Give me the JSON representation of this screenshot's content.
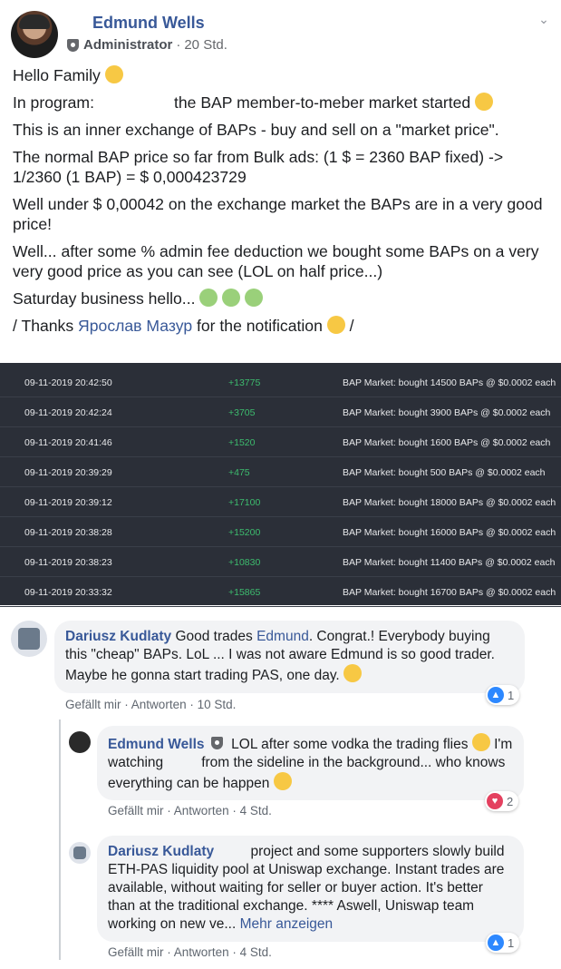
{
  "post": {
    "author": "Edmund Wells",
    "role": "Administrator",
    "time": "20 Std.",
    "lines": {
      "l1": "Hello Family",
      "l2a": "In program:",
      "l2b": "the BAP member-to-meber market started",
      "l3": "This is an inner exchange of BAPs - buy and sell on a \"market price\".",
      "l4": "The normal BAP price so far from Bulk ads: (1 $ = 2360 BAP fixed) -> 1/2360 (1 BAP) = $ 0,000423729",
      "l5": "Well under $ 0,00042 on the exchange market the BAPs are in a very good price!",
      "l6": "Well... after some % admin fee deduction we bought some BAPs on a very very good price as you can see (LOL on half price...)",
      "l7": "Saturday business hello...",
      "l8a": "/ Thanks",
      "l8_mention": "Ярослав Мазур",
      "l8b": "for the notification",
      "l8c": "/"
    }
  },
  "trades": [
    {
      "datetime": "09-11-2019 20:42:50",
      "amount": "+13775",
      "desc": "BAP Market: bought 14500 BAPs @ $0.0002 each"
    },
    {
      "datetime": "09-11-2019 20:42:24",
      "amount": "+3705",
      "desc": "BAP Market: bought 3900 BAPs @ $0.0002 each"
    },
    {
      "datetime": "09-11-2019 20:41:46",
      "amount": "+1520",
      "desc": "BAP Market: bought 1600 BAPs @ $0.0002 each"
    },
    {
      "datetime": "09-11-2019 20:39:29",
      "amount": "+475",
      "desc": "BAP Market: bought 500 BAPs @ $0.0002 each"
    },
    {
      "datetime": "09-11-2019 20:39:12",
      "amount": "+17100",
      "desc": "BAP Market: bought 18000 BAPs @ $0.0002 each"
    },
    {
      "datetime": "09-11-2019 20:38:28",
      "amount": "+15200",
      "desc": "BAP Market: bought 16000 BAPs @ $0.0002 each"
    },
    {
      "datetime": "09-11-2019 20:38:23",
      "amount": "+10830",
      "desc": "BAP Market: bought 11400 BAPs @ $0.0002 each"
    },
    {
      "datetime": "09-11-2019 20:33:32",
      "amount": "+15865",
      "desc": "BAP Market: bought 16700 BAPs @ $0.0002 each"
    }
  ],
  "comments": {
    "c1": {
      "author": "Dariusz Kudlaty",
      "t1": "Good trades",
      "mention": "Edmund",
      "t2": ". Congrat.! Everybody buying this \"cheap\" BAPs. LoL ... I was not aware Edmund is so good trader. Maybe he gonna start trading PAS, one day.",
      "like": "Gefällt mir",
      "reply": "Antworten",
      "time": "10 Std.",
      "reactions": "1"
    },
    "c2": {
      "author": "Edmund Wells",
      "t1": "LOL after some vodka the trading flies",
      "t2": "I'm watching",
      "t3": "from the sideline in the background... who knows everything can be happen",
      "like": "Gefällt mir",
      "reply": "Antworten",
      "time": "4 Std.",
      "reactions": "2"
    },
    "c3": {
      "author": "Dariusz Kudlaty",
      "t1": "project and some supporters slowly build ETH-PAS liquidity pool at Uniswap exchange. Instant trades are available, without waiting for seller or buyer action. It's better than at the traditional exchange. **** Aswell, Uniswap team working on new ve...",
      "more": "Mehr anzeigen",
      "like": "Gefällt mir",
      "reply": "Antworten",
      "time": "4 Std.",
      "reactions": "1"
    }
  },
  "ui": {
    "dot": "·"
  },
  "colors": {
    "link": "#385898",
    "green": "#3dbb6e",
    "table_bg": "#2b2f38",
    "like_blue": "#2d88ff",
    "love_red": "#e4405f"
  }
}
